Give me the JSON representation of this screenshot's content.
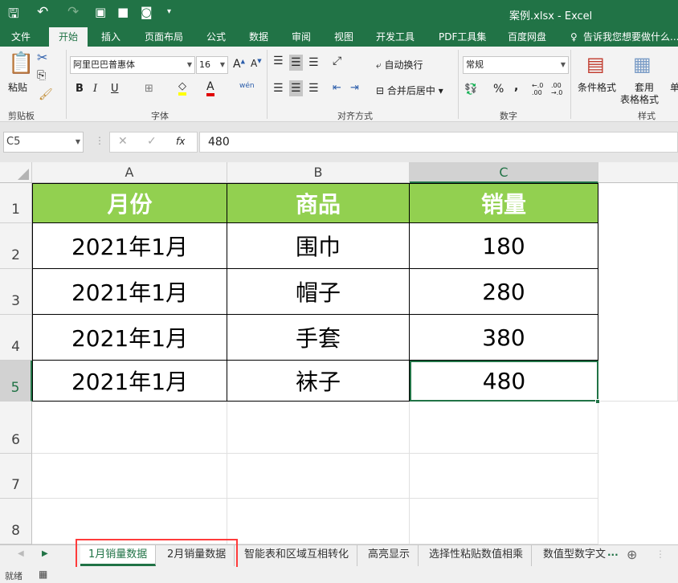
{
  "title": "案例.xlsx - Excel",
  "ribbon_tabs": [
    "文件",
    "开始",
    "插入",
    "页面布局",
    "公式",
    "数据",
    "审阅",
    "视图",
    "开发工具",
    "PDF工具集",
    "百度网盘"
  ],
  "tell_me": "告诉我您想要做什么...",
  "clipboard": {
    "paste": "粘贴",
    "group": "剪贴板"
  },
  "font": {
    "name": "阿里巴巴普惠体",
    "size": "16",
    "group": "字体",
    "bold": "B",
    "italic": "I",
    "underline": "U",
    "phonetic": "wén"
  },
  "align": {
    "wrap": "自动换行",
    "merge": "合并后居中",
    "group": "对齐方式"
  },
  "number": {
    "format": "常规",
    "percent": "%",
    "comma": ",",
    "group": "数字"
  },
  "styles": {
    "cond": "条件格式",
    "table1": "套用",
    "table2": "表格格式",
    "group": "样式",
    "more": "单"
  },
  "formula": {
    "namebox": "C5",
    "fx": "fx",
    "value": "480"
  },
  "columns": [
    "A",
    "B",
    "C"
  ],
  "rows": [
    "1",
    "2",
    "3",
    "4",
    "5",
    "6",
    "7",
    "8"
  ],
  "table": {
    "header": [
      "月份",
      "商品",
      "销量"
    ],
    "body": [
      [
        "2021年1月",
        "围巾",
        "180"
      ],
      [
        "2021年1月",
        "帽子",
        "280"
      ],
      [
        "2021年1月",
        "手套",
        "380"
      ],
      [
        "2021年1月",
        "袜子",
        "480"
      ]
    ]
  },
  "sheets": [
    "1月销量数据",
    "2月销量数据",
    "智能表和区域互相转化",
    "高亮显示",
    "选择性粘贴数值相乘",
    "数值型数字文"
  ],
  "sheets_more": "...",
  "status": "就绪",
  "colors": {
    "excel_green": "#217346",
    "header_fill": "#92d050",
    "highlight": "#ff3b3b"
  }
}
